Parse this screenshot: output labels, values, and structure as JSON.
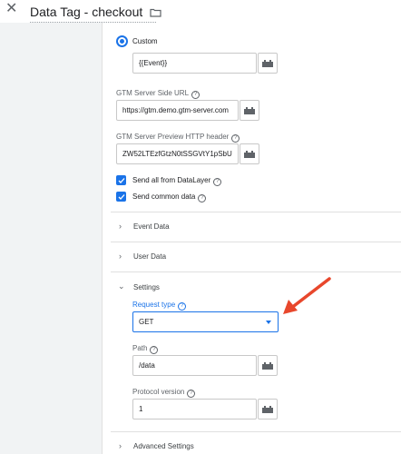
{
  "header": {
    "title": "Data Tag - checkout",
    "close_icon": "close-icon",
    "folder_icon": "folder-icon"
  },
  "custom": {
    "radio_label": "Custom",
    "event_value": "{{Event}}"
  },
  "server_url": {
    "label": "GTM Server Side URL",
    "value": "https://gtm.demo.gtm-server.com"
  },
  "preview_header": {
    "label": "GTM Server Preview HTTP header",
    "value": "ZW52LTEzfGtzN0tSSGVtY1pSbU"
  },
  "checkboxes": [
    {
      "label": "Send all from DataLayer",
      "checked": true
    },
    {
      "label": "Send common data",
      "checked": true
    }
  ],
  "sections": {
    "event_data": "Event Data",
    "user_data": "User Data",
    "settings": "Settings",
    "advanced_settings": "Advanced Settings"
  },
  "request_type": {
    "label": "Request type",
    "value": "GET"
  },
  "path": {
    "label": "Path",
    "value": "/data"
  },
  "protocol_version": {
    "label": "Protocol version",
    "value": "1"
  },
  "colors": {
    "accent": "#1a73e8",
    "arrow": "#e8472c"
  }
}
